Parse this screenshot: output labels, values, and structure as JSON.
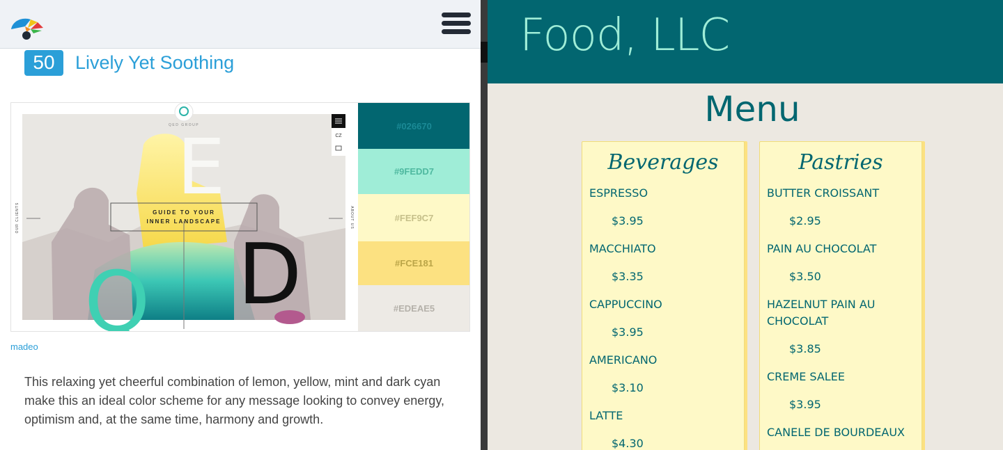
{
  "left_pane": {
    "palette_number": "50",
    "palette_title": "Lively Yet Soothing",
    "preview": {
      "brand": "QED GROUP",
      "tagline_line1": "GUIDE TO YOUR",
      "tagline_line2": "INNER LANDSCAPE",
      "side_left": "OUR CLIENTS",
      "side_right": "ABOUT US",
      "lang": "CZ",
      "letter_e": "E",
      "letter_d": "D",
      "letter_q": "Q"
    },
    "swatches": [
      {
        "hex": "#026670",
        "label": "#026670",
        "text_color": "#1b8a96"
      },
      {
        "hex": "#9FEDD7",
        "label": "#9FEDD7",
        "text_color": "#4fb9a0"
      },
      {
        "hex": "#FEF9C7",
        "label": "#FEF9C7",
        "text_color": "#c6c08a"
      },
      {
        "hex": "#FCE181",
        "label": "#FCE181",
        "text_color": "#bba548"
      },
      {
        "hex": "#EDEAE5",
        "label": "#EDEAE5",
        "text_color": "#b5b1aa"
      }
    ],
    "credit": "madeo",
    "description": "This relaxing yet cheerful combination of lemon, yellow, mint and dark cyan make this an ideal color scheme for any message looking to convey energy, optimism and, at the same time, harmony and growth."
  },
  "right_pane": {
    "site_title": "Food, LLC",
    "menu_title": "Menu",
    "cards": [
      {
        "title": "Beverages",
        "items": [
          {
            "name": "ESPRESSO",
            "price": "$3.95"
          },
          {
            "name": "MACCHIATO",
            "price": "$3.35"
          },
          {
            "name": "CAPPUCCINO",
            "price": "$3.95"
          },
          {
            "name": "AMERICANO",
            "price": "$3.10"
          },
          {
            "name": "LATTE",
            "price": "$4.30"
          }
        ]
      },
      {
        "title": "Pastries",
        "items": [
          {
            "name": "BUTTER CROISSANT",
            "price": "$2.95"
          },
          {
            "name": "PAIN AU CHOCOLAT",
            "price": "$3.50"
          },
          {
            "name": "HAZELNUT PAIN AU CHOCOLAT",
            "price": "$3.85"
          },
          {
            "name": "CREME SALEE",
            "price": "$3.95"
          },
          {
            "name": "CANELE DE BOURDEAUX",
            "price": ""
          }
        ]
      }
    ]
  },
  "colors": {
    "dark_cyan": "#026670",
    "mint": "#9FEDD7",
    "lemon": "#FEF9C7",
    "yellow": "#FCE181",
    "beige": "#EDEAE5",
    "link_blue": "#2b9fd8"
  },
  "icons": {
    "logo": "parrot-logo-icon",
    "menu": "hamburger-menu-icon"
  }
}
